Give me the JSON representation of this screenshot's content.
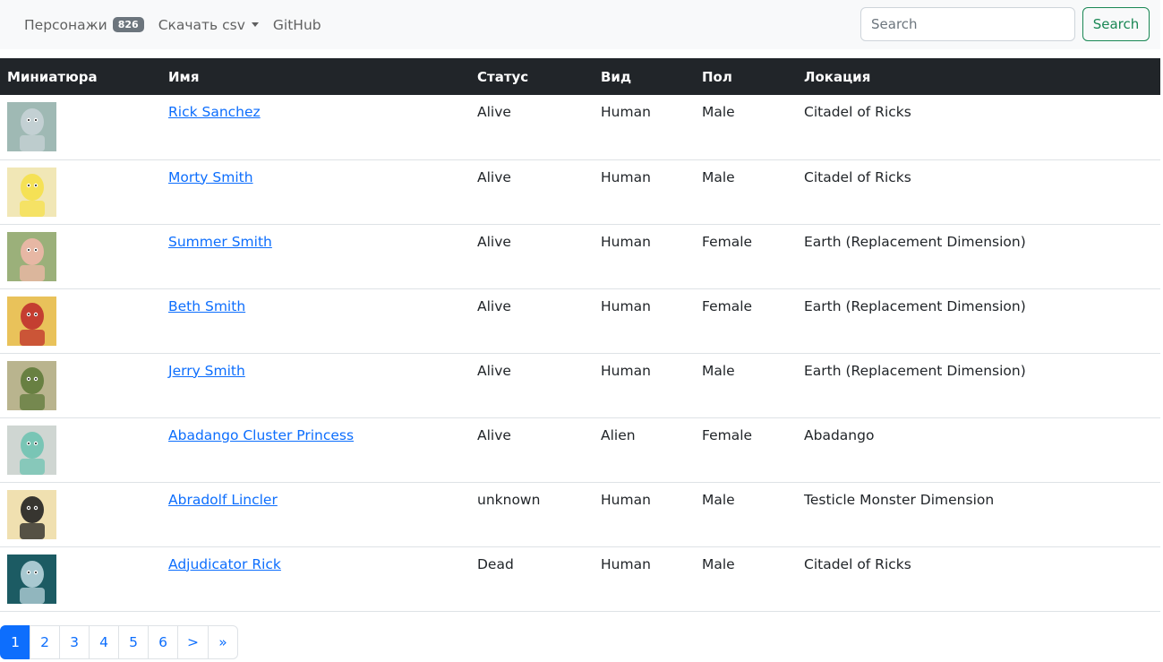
{
  "navbar": {
    "characters_label": "Персонажи",
    "characters_count": "826",
    "download_label": "Скачать csv",
    "github_label": "GitHub",
    "search_placeholder": "Search",
    "search_button": "Search"
  },
  "table": {
    "headers": {
      "thumbnail": "Миниатюра",
      "name": "Имя",
      "status": "Статус",
      "species": "Вид",
      "gender": "Пол",
      "location": "Локация"
    },
    "rows": [
      {
        "name": "Rick Sanchez",
        "status": "Alive",
        "species": "Human",
        "gender": "Male",
        "location": "Citadel of Ricks",
        "thumb_bg": "#9fb9b4",
        "thumb_fg": "#c7d3d6"
      },
      {
        "name": "Morty Smith",
        "status": "Alive",
        "species": "Human",
        "gender": "Male",
        "location": "Citadel of Ricks",
        "thumb_bg": "#f1e7b6",
        "thumb_fg": "#f5e04a"
      },
      {
        "name": "Summer Smith",
        "status": "Alive",
        "species": "Human",
        "gender": "Female",
        "location": "Earth (Replacement Dimension)",
        "thumb_bg": "#9bb07a",
        "thumb_fg": "#f0b8a8"
      },
      {
        "name": "Beth Smith",
        "status": "Alive",
        "species": "Human",
        "gender": "Female",
        "location": "Earth (Replacement Dimension)",
        "thumb_bg": "#e9c25a",
        "thumb_fg": "#c0302c"
      },
      {
        "name": "Jerry Smith",
        "status": "Alive",
        "species": "Human",
        "gender": "Male",
        "location": "Earth (Replacement Dimension)",
        "thumb_bg": "#b9b48e",
        "thumb_fg": "#5f7a3a"
      },
      {
        "name": "Abadango Cluster Princess",
        "status": "Alive",
        "species": "Alien",
        "gender": "Female",
        "location": "Abadango",
        "thumb_bg": "#cfd6d2",
        "thumb_fg": "#6fc3b1"
      },
      {
        "name": "Abradolf Lincler",
        "status": "unknown",
        "species": "Human",
        "gender": "Male",
        "location": "Testicle Monster Dimension",
        "thumb_bg": "#f0e0b0",
        "thumb_fg": "#222222"
      },
      {
        "name": "Adjudicator Rick",
        "status": "Dead",
        "species": "Human",
        "gender": "Male",
        "location": "Citadel of Ricks",
        "thumb_bg": "#1c5b63",
        "thumb_fg": "#b8d4dc"
      }
    ]
  },
  "pagination": {
    "pages": [
      "1",
      "2",
      "3",
      "4",
      "5",
      "6"
    ],
    "next": ">",
    "last": "»",
    "active_page": "1"
  }
}
